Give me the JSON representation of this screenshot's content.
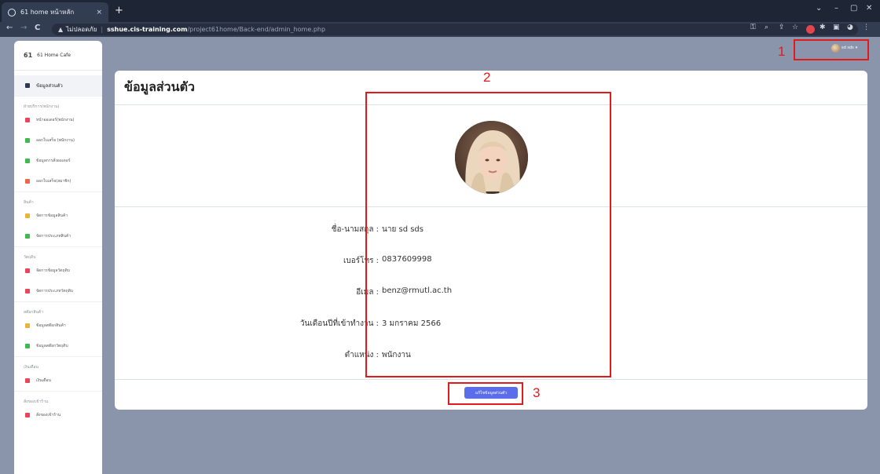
{
  "browser": {
    "tab_title": "61 home หน้าหลัก",
    "tab_close": "×",
    "new_tab": "+",
    "window_controls": [
      "⌄",
      "–",
      "▢",
      "✕"
    ],
    "nav_back": "←",
    "nav_forward": "→",
    "nav_reload": "C",
    "warning_icon": "▲",
    "not_secure": "ไม่ปลอดภัย",
    "url_host": "sshue.cis-training.com",
    "url_path": "/project61home/Back-end/admin_home.php"
  },
  "sidebar": {
    "brand_logo": "61",
    "brand_name": "61 Home Cafe",
    "active_item": "ข้อมูลส่วนตัว",
    "groups": [
      {
        "heading": "ฝ่ายบริการ(พนักงาน)",
        "items": [
          {
            "label": "หน้าออเดอร์(พนักงาน)",
            "color": "#e9465a"
          },
          {
            "label": "ออกใบเสร็จ (พนักงาน)",
            "color": "#3fb950"
          },
          {
            "label": "ข้อมูลการสั่งออเดอร์",
            "color": "#3fb950"
          },
          {
            "label": "ออกใบเสร็จ(สมาชิก)",
            "color": "#f0664a"
          }
        ]
      },
      {
        "heading": "สินค้า",
        "items": [
          {
            "label": "จัดการข้อมูลสินค้า",
            "color": "#e9b43a"
          },
          {
            "label": "จัดการประเภทสินค้า",
            "color": "#3fb950"
          }
        ]
      },
      {
        "heading": "วัตถุดิบ",
        "items": [
          {
            "label": "จัดการข้อมูลวัตถุดิบ",
            "color": "#e9465a"
          },
          {
            "label": "จัดการประเภทวัตถุดิบ",
            "color": "#e9465a"
          }
        ]
      },
      {
        "heading": "สต๊อกสินค้า",
        "items": [
          {
            "label": "ข้อมูลสต๊อกสินค้า",
            "color": "#e9b43a"
          },
          {
            "label": "ข้อมูลสต๊อกวัตถุดิบ",
            "color": "#3fb950"
          }
        ]
      },
      {
        "heading": "เงินเดือน",
        "items": [
          {
            "label": "เงินเดือน",
            "color": "#e9465a"
          }
        ]
      },
      {
        "heading": "สั่งของเข้าร้าน",
        "items": [
          {
            "label": "สั่งของเข้าร้าน",
            "color": "#e9465a"
          }
        ]
      }
    ]
  },
  "header": {
    "user_name": "sd sds",
    "user_caret": "▾"
  },
  "main": {
    "title": "ข้อมูลส่วนตัว",
    "fields": [
      {
        "label": "ชื่อ-นามสกุล :",
        "value": "นาย sd sds"
      },
      {
        "label": "เบอร์โทร :",
        "value": "0837609998"
      },
      {
        "label": "อีเมล :",
        "value": "benz@rmutl.ac.th"
      },
      {
        "label": "วันเดือนปีที่เข้าทำงาน :",
        "value": "3 มกราคม 2566"
      },
      {
        "label": "ตำแหน่ง :",
        "value": "พนักงาน"
      }
    ],
    "edit_button_label": "แก้ไขข้อมูลส่วนตัว"
  },
  "annotations": [
    "1",
    "2",
    "3"
  ],
  "colors": {
    "accent": "#5b6dea",
    "annotation": "#e41a1a",
    "page_bg": "#8a95ac"
  }
}
